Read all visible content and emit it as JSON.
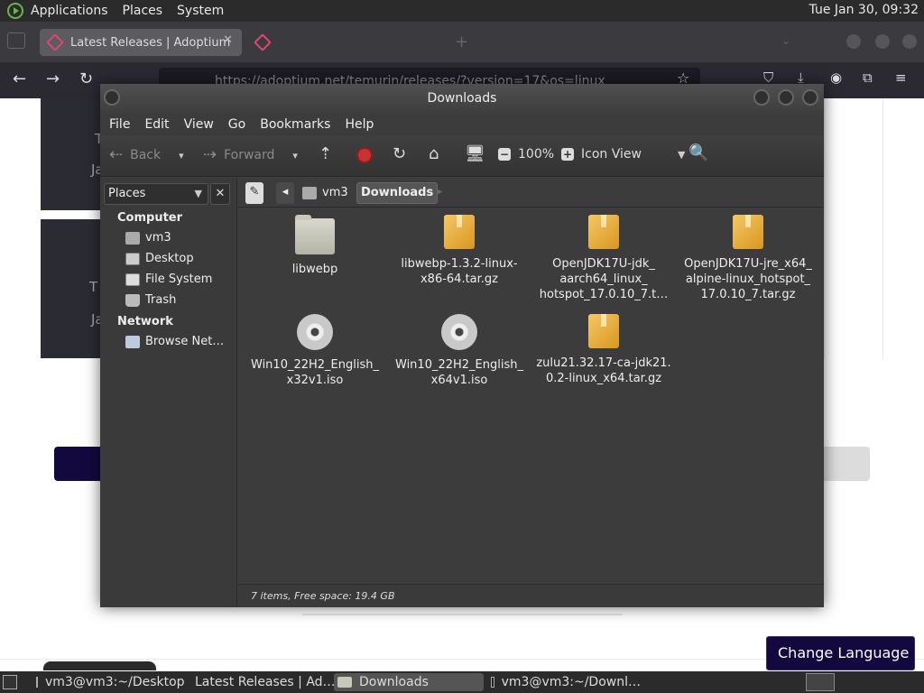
{
  "top_panel": {
    "menus": [
      "Applications",
      "Places",
      "System"
    ],
    "clock": "Tue Jan 30, 09:32"
  },
  "browser": {
    "tabs": [
      {
        "label": "Latest Releases | Adoptium",
        "active": true
      },
      {
        "label": "",
        "active": false
      }
    ],
    "url": "https://adoptium.net/temurin/releases/?version=17&os=linux"
  },
  "webpage": {
    "card1_lines": [
      "T",
      "Ja"
    ],
    "card2_lines": [
      "T",
      "Ja"
    ],
    "change_language": "Change Language ▾"
  },
  "file_manager": {
    "title": "Downloads",
    "menu": [
      "File",
      "Edit",
      "View",
      "Go",
      "Bookmarks",
      "Help"
    ],
    "toolbar": {
      "back": "Back",
      "forward": "Forward",
      "zoom": "100%",
      "view_mode": "Icon View"
    },
    "sidebar": {
      "combo": "Places",
      "sections": [
        {
          "header": "Computer",
          "items": [
            "vm3",
            "Desktop",
            "File System",
            "Trash"
          ]
        },
        {
          "header": "Network",
          "items": [
            "Browse Net…"
          ]
        }
      ]
    },
    "location": {
      "parent": "vm3",
      "current": "Downloads"
    },
    "files": [
      {
        "name": "libwebp",
        "icon": "folder-icon"
      },
      {
        "name": "libwebp-1.3.2-linux-x86-64.tar.gz",
        "icon": "package-icon",
        "lines": [
          "libwebp-1.3.2-linux-",
          "x86-64.tar.gz"
        ]
      },
      {
        "name": "OpenJDK17U-jdk_aarch64_linux_hotspot_17.0.10_7.t…",
        "icon": "package-icon",
        "lines": [
          "OpenJDK17U-jdk_",
          "aarch64_linux_",
          "hotspot_17.0.10_7.t…"
        ]
      },
      {
        "name": "OpenJDK17U-jre_x64_alpine-linux_hotspot_17.0.10_7.tar.gz",
        "icon": "package-icon",
        "lines": [
          "OpenJDK17U-jre_x64_",
          "alpine-linux_hotspot_",
          "17.0.10_7.tar.gz"
        ]
      },
      {
        "name": "Win10_22H2_English_x32v1.iso",
        "icon": "disc-icon",
        "lines": [
          "Win10_22H2_English_",
          "x32v1.iso"
        ]
      },
      {
        "name": "Win10_22H2_English_x64v1.iso",
        "icon": "disc-icon",
        "lines": [
          "Win10_22H2_English_",
          "x64v1.iso"
        ]
      },
      {
        "name": "zulu21.32.17-ca-jdk21.0.2-linux_x64.tar.gz",
        "icon": "package-icon",
        "lines": [
          "zulu21.32.17-ca-jdk21.",
          "0.2-linux_x64.tar.gz"
        ]
      }
    ],
    "status": "7 items, Free space: 19.4 GB"
  },
  "taskbar": {
    "tasks": [
      {
        "label": "vm3@vm3:~/Desktop",
        "icon": "terminal-icon",
        "active": false
      },
      {
        "label": "Latest Releases | Ad…",
        "icon": "firefox-icon",
        "active": false
      },
      {
        "label": "Downloads",
        "icon": "folder-icon",
        "active": true
      },
      {
        "label": "vm3@vm3:~/Downl…",
        "icon": "terminal-icon",
        "active": false
      }
    ]
  },
  "colors": {
    "accent_purple": "#14093f",
    "panel": "#2b2b2b",
    "fm_bg": "#3c3c3c"
  }
}
